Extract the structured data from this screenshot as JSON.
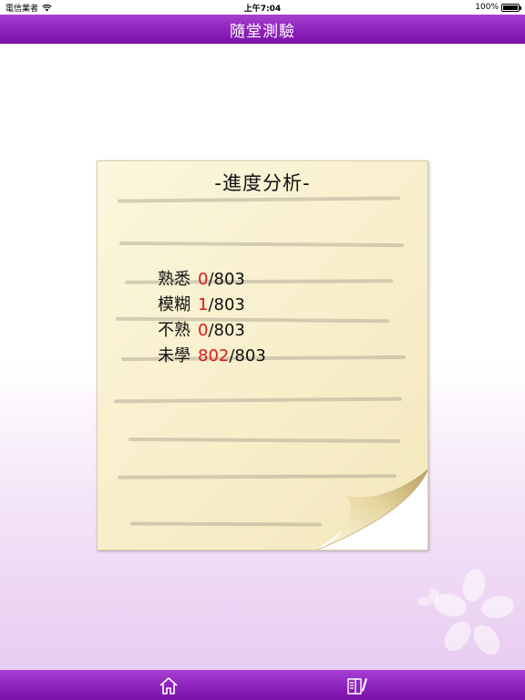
{
  "status_bar": {
    "carrier": "電信業者",
    "time": "上午7:04",
    "battery": "100%",
    "battery_level": 1.0
  },
  "header": {
    "title": "隨堂測驗"
  },
  "note": {
    "title": "-進度分析-",
    "stats": [
      {
        "label": "熟悉",
        "value": "0",
        "total": "/803"
      },
      {
        "label": "模糊",
        "value": "1",
        "total": "/803"
      },
      {
        "label": "不熟",
        "value": "0",
        "total": "/803"
      },
      {
        "label": "未學",
        "value": "802",
        "total": "/803"
      }
    ]
  },
  "tab_bar": {
    "items": [
      {
        "icon": "home-icon"
      },
      {
        "icon": "notebook-icon"
      }
    ]
  },
  "colors": {
    "header_purple": "#8a20b8",
    "count_red": "#e01818",
    "paper": "#f8efcc"
  }
}
